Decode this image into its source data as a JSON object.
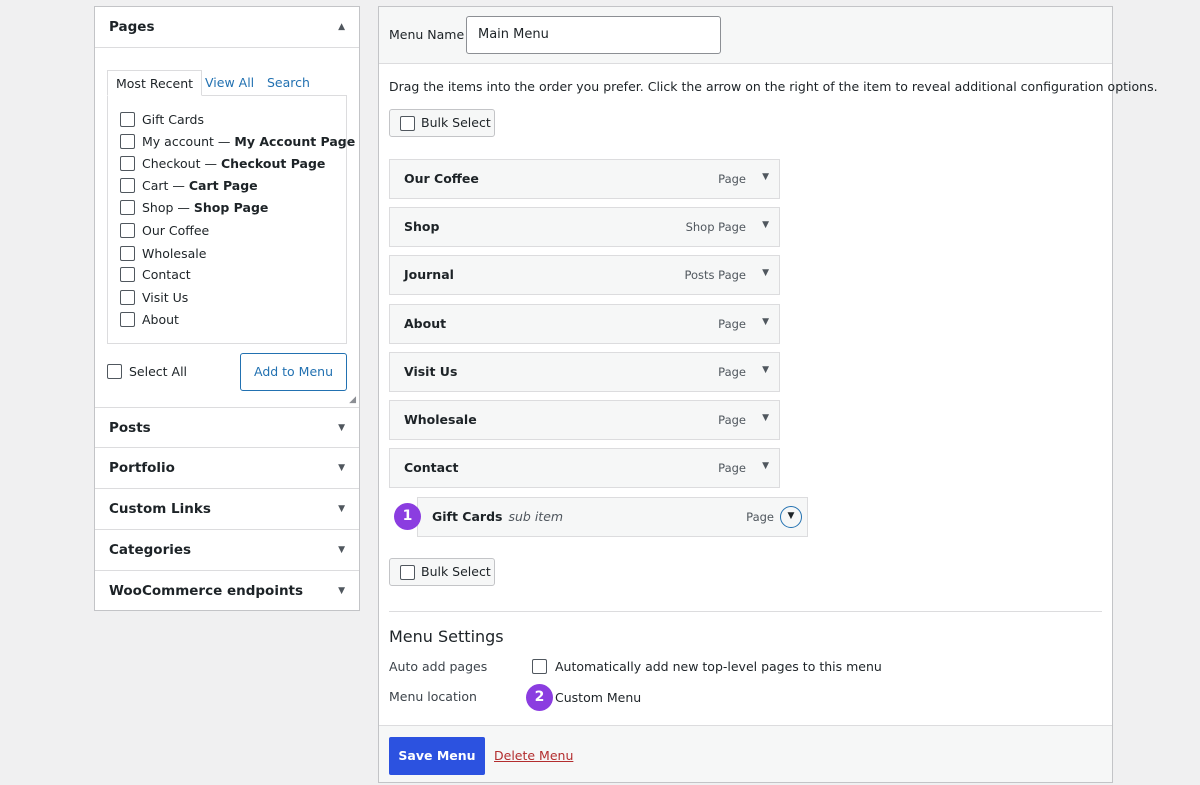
{
  "left": {
    "pages_panel": {
      "title": "Pages",
      "tabs": [
        "Most Recent",
        "View All",
        "Search"
      ],
      "items": [
        {
          "label": "Gift Cards",
          "suffix": ""
        },
        {
          "label": "My account — ",
          "suffix": "My Account Page"
        },
        {
          "label": "Checkout — ",
          "suffix": "Checkout Page"
        },
        {
          "label": "Cart — ",
          "suffix": "Cart Page"
        },
        {
          "label": "Shop — ",
          "suffix": "Shop Page"
        },
        {
          "label": "Our Coffee",
          "suffix": ""
        },
        {
          "label": "Wholesale",
          "suffix": ""
        },
        {
          "label": "Contact",
          "suffix": ""
        },
        {
          "label": "Visit Us",
          "suffix": ""
        },
        {
          "label": "About",
          "suffix": ""
        }
      ],
      "select_all_label": "Select All",
      "add_button_label": "Add to Menu"
    },
    "collapsed_panels": [
      "Posts",
      "Portfolio",
      "Custom Links",
      "Categories",
      "WooCommerce endpoints"
    ]
  },
  "menu": {
    "name_label": "Menu Name",
    "name_value": "Main Menu",
    "instructions": "Drag the items into the order you prefer. Click the arrow on the right of the item to reveal additional configuration options.",
    "bulk_select_label": "Bulk Select",
    "items": [
      {
        "title": "Our Coffee",
        "type": "Page"
      },
      {
        "title": "Shop",
        "type": "Shop Page"
      },
      {
        "title": "Journal",
        "type": "Posts Page"
      },
      {
        "title": "About",
        "type": "Page"
      },
      {
        "title": "Visit Us",
        "type": "Page"
      },
      {
        "title": "Wholesale",
        "type": "Page"
      },
      {
        "title": "Contact",
        "type": "Page"
      }
    ],
    "sub_item": {
      "title": "Gift Cards",
      "sub_label": "sub item",
      "type": "Page"
    },
    "settings": {
      "title": "Menu Settings",
      "auto_add_label": "Auto add pages",
      "auto_add_option": "Automatically add new top-level pages to this menu",
      "location_label": "Menu location",
      "location_option": "Custom Menu"
    },
    "save_label": "Save Menu",
    "delete_label": "Delete Menu"
  },
  "annotations": [
    "1",
    "2"
  ],
  "colors": {
    "accent": "#2271b1",
    "save_button": "#2c52e0",
    "badge": "#8b3de0",
    "delete": "#b32d2e"
  }
}
